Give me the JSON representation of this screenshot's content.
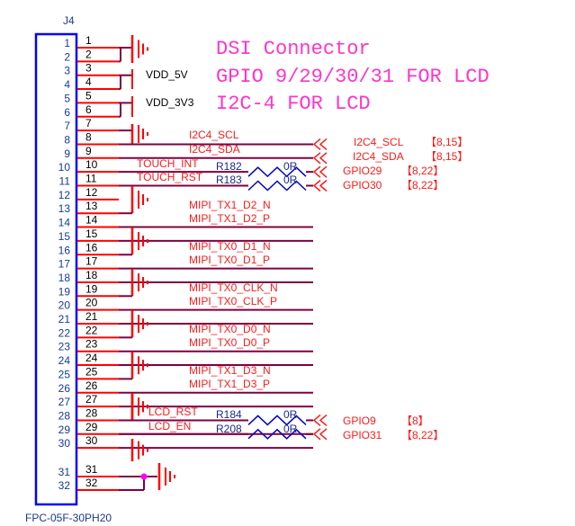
{
  "connector": {
    "designator": "J4",
    "part_number": "FPC-05F-30PH20",
    "inner_pins": [
      "1",
      "2",
      "3",
      "4",
      "5",
      "6",
      "7",
      "8",
      "9",
      "10",
      "11",
      "12",
      "13",
      "14",
      "15",
      "16",
      "17",
      "18",
      "19",
      "20",
      "21",
      "22",
      "23",
      "24",
      "25",
      "26",
      "27",
      "28",
      "29",
      "30",
      "31",
      "32"
    ],
    "outer_pins": [
      "1",
      "2",
      "3",
      "4",
      "5",
      "6",
      "7",
      "8",
      "9",
      "10",
      "11",
      "12",
      "13",
      "14",
      "15",
      "16",
      "17",
      "18",
      "19",
      "20",
      "21",
      "22",
      "23",
      "24",
      "25",
      "26",
      "27",
      "28",
      "29",
      "30",
      "31",
      "32"
    ]
  },
  "titles": {
    "line1": "DSI Connector",
    "line2": "GPIO 9/29/30/31 FOR LCD",
    "line3": "I2C-4  FOR LCD"
  },
  "power": {
    "vdd5": "VDD_5V",
    "vdd3": "VDD_3V3"
  },
  "nets": {
    "i2c_scl": "I2C4_SCL",
    "i2c_sda": "I2C4_SDA",
    "touch_int": "TOUCH_INT",
    "touch_rst": "TOUCH_RST",
    "tx1_d2_n": "MIPI_TX1_D2_N",
    "tx1_d2_p": "MIPI_TX1_D2_P",
    "tx0_d1_n": "MIPI_TX0_D1_N",
    "tx0_d1_p": "MIPI_TX0_D1_P",
    "tx0_clk_n": "MIPI_TX0_CLK_N",
    "tx0_clk_p": "MIPI_TX0_CLK_P",
    "tx0_d0_n": "MIPI_TX0_D0_N",
    "tx0_d0_p": "MIPI_TX0_D0_P",
    "tx1_d3_n": "MIPI_TX1_D3_N",
    "tx1_d3_p": "MIPI_TX1_D3_P",
    "lcd_rst": "LCD_RST",
    "lcd_en": "LCD_EN"
  },
  "resistors": [
    {
      "ref": "R182",
      "value": "0R"
    },
    {
      "ref": "R183",
      "value": "0R"
    },
    {
      "ref": "R184",
      "value": "0R"
    },
    {
      "ref": "R208",
      "value": "0R"
    }
  ],
  "offpage": [
    {
      "name": "I2C4_SCL",
      "pages": "【8,15】"
    },
    {
      "name": "I2C4_SDA",
      "pages": "【8,15】"
    },
    {
      "name": "GPIO29",
      "pages": "【8,22】"
    },
    {
      "name": "GPIO30",
      "pages": "【8,22】"
    },
    {
      "name": "GPIO9",
      "pages": "【8】"
    },
    {
      "name": "GPIO31",
      "pages": "【8,22】"
    }
  ],
  "colors": {
    "box": "#0000ff",
    "pin": "#ff0000",
    "wire": "#800040",
    "title": "#ff33cc",
    "net": "#ff1a1a",
    "junction": "#ff00ff",
    "resistor": "#0000cc"
  }
}
